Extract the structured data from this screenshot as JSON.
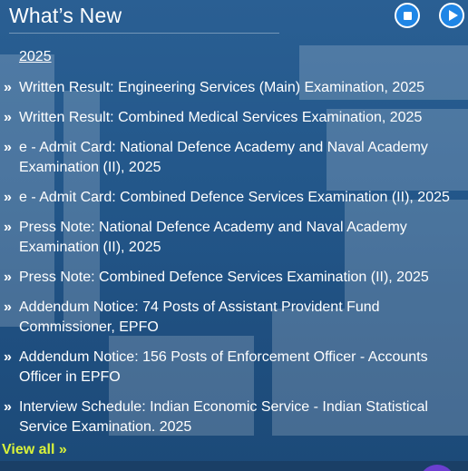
{
  "header": {
    "title": "What’s New",
    "stop_icon": "stop-icon",
    "play_icon": "play-icon",
    "accent_color": "#1f86e6"
  },
  "year_label": "2025",
  "bullet_glyph": "»",
  "items": [
    {
      "text": "Written Result: Engineering Services (Main) Examination, 2025"
    },
    {
      "text": "Written Result: Combined Medical Services Examination, 2025"
    },
    {
      "text": "e - Admit Card: National Defence Academy and Naval Academy Examination (II), 2025"
    },
    {
      "text": "e - Admit Card: Combined Defence Services Examination (II), 2025"
    },
    {
      "text": "Press Note: National Defence Academy and Naval Academy Examination (II), 2025"
    },
    {
      "text": "Press Note: Combined Defence Services Examination (II), 2025"
    },
    {
      "text": "Addendum Notice: 74 Posts of Assistant Provident Fund Commissioner, EPFO"
    },
    {
      "text": "Addendum Notice: 156 Posts of Enforcement Officer - Accounts Officer in EPFO"
    },
    {
      "text": "Interview Schedule: Indian Economic Service - Indian Statistical Service Examination. 2025"
    }
  ],
  "view_all_label": "View all »",
  "view_all_color": "#d9f23a"
}
